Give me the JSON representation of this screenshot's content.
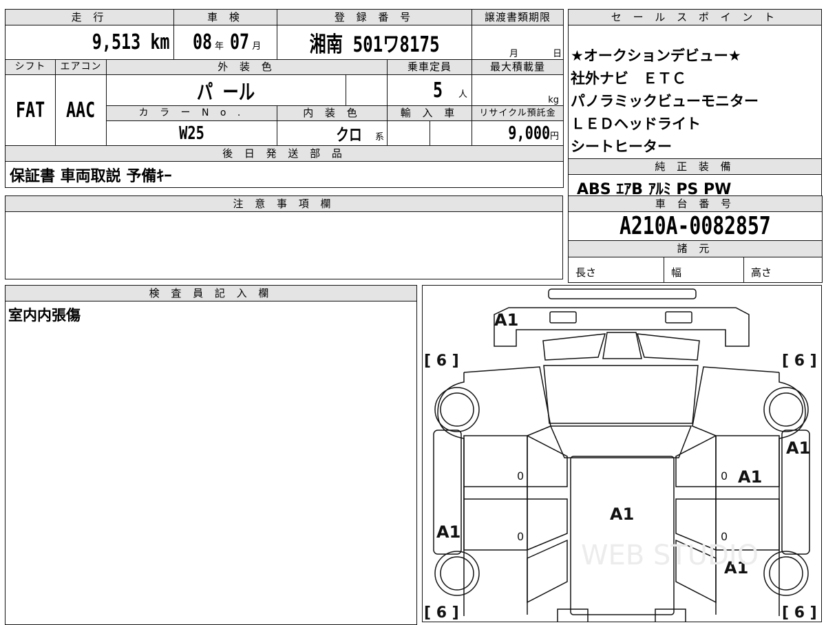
{
  "header": {
    "mileage_label": "走 行",
    "inspection_label": "車 検",
    "registration_label": "登 録 番 号",
    "transfer_label": "譲渡書類期限",
    "sales_label": "セ ー ル ス ポ イ ン ト"
  },
  "values": {
    "mileage": "9,513",
    "mileage_unit": "km",
    "inspection_year": "08",
    "year_unit": "年",
    "inspection_month": "07",
    "month_unit": "月",
    "registration": "湘南 501ワ8175",
    "transfer_month_unit": "月",
    "transfer_day_unit": "日"
  },
  "row2": {
    "shift_label": "シフト",
    "ac_label": "エアコン",
    "exterior_label": "外 装 色",
    "capacity_label": "乗車定員",
    "maxload_label": "最大積載量",
    "shift": "FAT",
    "ac": "AAC",
    "exterior": "パ ール",
    "capacity": "5",
    "capacity_unit": "人",
    "maxload_unit": "kg",
    "colorno_label": "カ ラ ー N o .",
    "interior_label": "内 装 色",
    "import_label": "輸 入 車",
    "recycle_label": "リサイクル預託金",
    "colorno": "W25",
    "interior": "クロ",
    "interior_unit": "系",
    "recycle": "9,000",
    "recycle_unit": "円"
  },
  "sales_points": [
    "★オークションデビュー★",
    "社外ナビ　ＥＴＣ",
    "パノラミックビューモニター",
    "ＬＥＤヘッドライト",
    "シートヒーター"
  ],
  "later_parts": {
    "label": "後 日 発 送 部 品",
    "value": "保証書 車両取説 予備ｷｰ"
  },
  "genuine": {
    "label": "純 正 装 備",
    "value": "ABS ｴｱB ｱﾙﾐ PS PW"
  },
  "notes": {
    "label": "注 意 事 項 欄"
  },
  "chassis": {
    "label": "車 台 番 号",
    "value": "A210A-0082857",
    "spec_label": "諸 元",
    "length": "長さ",
    "width": "幅",
    "height": "高さ"
  },
  "inspector": {
    "label": "検 査 員 記 入 欄",
    "value": "室内内張傷"
  },
  "diagram": {
    "tire_fl": "[ 6 ]",
    "tire_fr": "[ 6 ]",
    "tire_rl": "[ 6 ]",
    "tire_rr": "[ 6 ]",
    "mark_front": "A1",
    "mark_right_front": "A1",
    "mark_right_door": "A1",
    "mark_roof": "A1",
    "mark_left_rear": "A1",
    "mark_right_rear": "A1",
    "zero": "0",
    "watermark": "WEB STUDIO"
  }
}
